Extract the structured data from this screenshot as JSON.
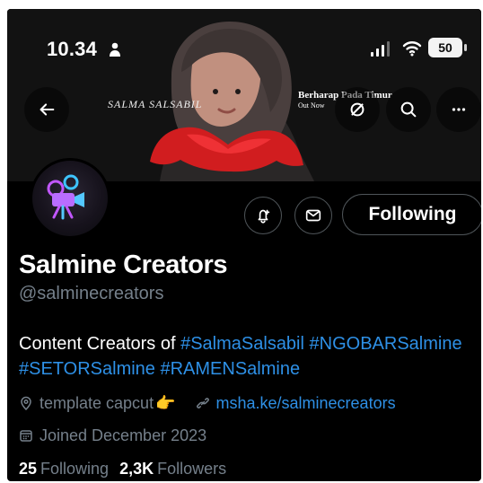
{
  "status_bar": {
    "time": "10.34",
    "battery": "50",
    "icons": [
      "person-icon",
      "signal-icon",
      "wifi-icon",
      "battery-icon"
    ]
  },
  "banner": {
    "left_text": "SALMA SALSABIL",
    "right_title": "Berharap Pada Timur",
    "right_subtitle": "Out Now"
  },
  "nav": {
    "buttons": [
      "back-arrow-icon",
      "grok-icon",
      "search-icon",
      "more-icon"
    ]
  },
  "profile": {
    "name": "Salmine Creators",
    "handle": "@salminecreators",
    "bio_prefix": "Content Creators of ",
    "bio_tags": [
      "#SalmaSalsabil",
      "#NGOBARSalmine",
      "#SETORSalmine",
      "#RAMENSalmine"
    ],
    "location": "template capcut",
    "location_emoji": "👉",
    "website": "msha.ke/salminecreators",
    "joined": "Joined December 2023",
    "following_count": "25",
    "following_label": "Following",
    "followers_count": "2,3K",
    "followers_label": "Followers"
  },
  "actions": {
    "following_button": "Following",
    "icons": [
      "notification-bell-icon",
      "message-icon"
    ]
  },
  "colors": {
    "background": "#000000",
    "text_primary": "#ffffff",
    "text_secondary": "#75808b",
    "link": "#2e90e6",
    "border": "#4f5559"
  }
}
